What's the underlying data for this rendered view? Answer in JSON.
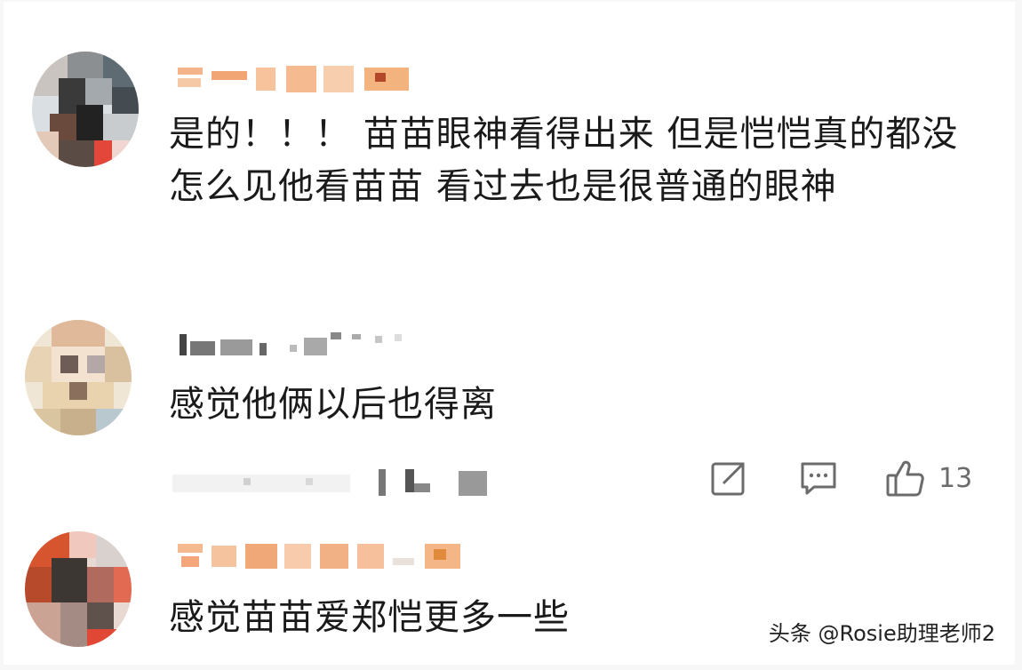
{
  "comments": [
    {
      "text": "是的！！！ 苗苗眼神看得出来  但是恺恺真的都没怎么见他看苗苗  看过去也是很普通的眼神"
    },
    {
      "text": "感觉他俩以后也得离",
      "likes": "13"
    },
    {
      "text": "感觉苗苗爱郑恺更多一些"
    }
  ],
  "icons": {
    "share": "share-icon",
    "comment": "comment-icon",
    "like": "thumbs-up-icon"
  },
  "colors": {
    "text": "#1a1a1a",
    "icon": "#6b6b6b",
    "background": "#ffffff"
  },
  "watermark": "头条 @Rosie助理老师2"
}
